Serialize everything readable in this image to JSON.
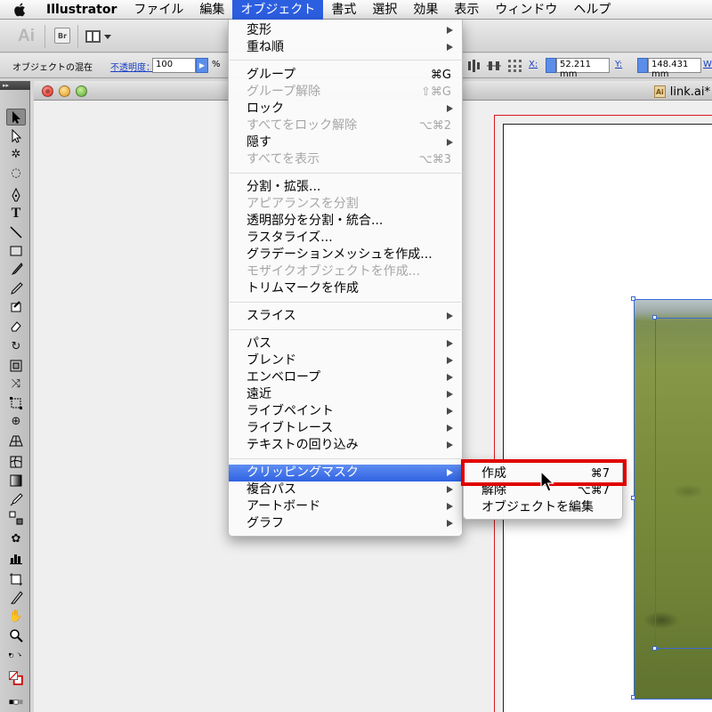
{
  "menubar": {
    "app_name": "Illustrator",
    "items": [
      "ファイル",
      "編集",
      "オブジェクト",
      "書式",
      "選択",
      "効果",
      "表示",
      "ウィンドウ",
      "ヘルプ"
    ],
    "active": "オブジェクト"
  },
  "toolbar": {
    "app_logo": "Ai",
    "bridge_label": "Br"
  },
  "control_bar": {
    "label": "オブジェクトの混在",
    "opacity_label": "不透明度：",
    "opacity_value": "100",
    "opacity_unit": "%",
    "x_label": "X:",
    "x_value": "52.211 mm",
    "y_label": "Y:",
    "y_value": "148.431 mm",
    "w_label": "W"
  },
  "document": {
    "tab_title": "link.ai*"
  },
  "object_menu": {
    "items": [
      {
        "label": "変形",
        "submenu": true,
        "enabled": true
      },
      {
        "label": "重ね順",
        "submenu": true,
        "enabled": true
      },
      {
        "label": "グループ",
        "shortcut": "⌘G",
        "enabled": true
      },
      {
        "label": "グループ解除",
        "shortcut": "⇧⌘G",
        "enabled": false
      },
      {
        "label": "ロック",
        "submenu": true,
        "enabled": true
      },
      {
        "label": "すべてをロック解除",
        "shortcut": "⌥⌘2",
        "enabled": false
      },
      {
        "label": "隠す",
        "submenu": true,
        "enabled": true
      },
      {
        "label": "すべてを表示",
        "shortcut": "⌥⌘3",
        "enabled": false
      },
      {
        "label": "分割・拡張...",
        "enabled": true
      },
      {
        "label": "アピアランスを分割",
        "enabled": false
      },
      {
        "label": "透明部分を分割・統合...",
        "enabled": true
      },
      {
        "label": "ラスタライズ...",
        "enabled": true
      },
      {
        "label": "グラデーションメッシュを作成...",
        "enabled": true
      },
      {
        "label": "モザイクオブジェクトを作成...",
        "enabled": false
      },
      {
        "label": "トリムマークを作成",
        "enabled": true
      },
      {
        "label": "スライス",
        "submenu": true,
        "enabled": true
      },
      {
        "label": "パス",
        "submenu": true,
        "enabled": true
      },
      {
        "label": "ブレンド",
        "submenu": true,
        "enabled": true
      },
      {
        "label": "エンベロープ",
        "submenu": true,
        "enabled": true
      },
      {
        "label": "遠近",
        "submenu": true,
        "enabled": true
      },
      {
        "label": "ライブペイント",
        "submenu": true,
        "enabled": true
      },
      {
        "label": "ライブトレース",
        "submenu": true,
        "enabled": true
      },
      {
        "label": "テキストの回り込み",
        "submenu": true,
        "enabled": true
      },
      {
        "label": "クリッピングマスク",
        "submenu": true,
        "enabled": true,
        "highlighted": true
      },
      {
        "label": "複合パス",
        "submenu": true,
        "enabled": true
      },
      {
        "label": "アートボード",
        "submenu": true,
        "enabled": true
      },
      {
        "label": "グラフ",
        "submenu": true,
        "enabled": true
      }
    ]
  },
  "clipping_submenu": {
    "items": [
      {
        "label": "作成",
        "shortcut": "⌘7"
      },
      {
        "label": "解除",
        "shortcut": "⌥⌘7"
      },
      {
        "label": "オブジェクトを編集"
      }
    ]
  },
  "colors": {
    "menu_highlight": "#2f62e3",
    "callout_red": "#e00000",
    "bleed_red": "#d9191c",
    "selection_blue": "#3b6ad6"
  }
}
